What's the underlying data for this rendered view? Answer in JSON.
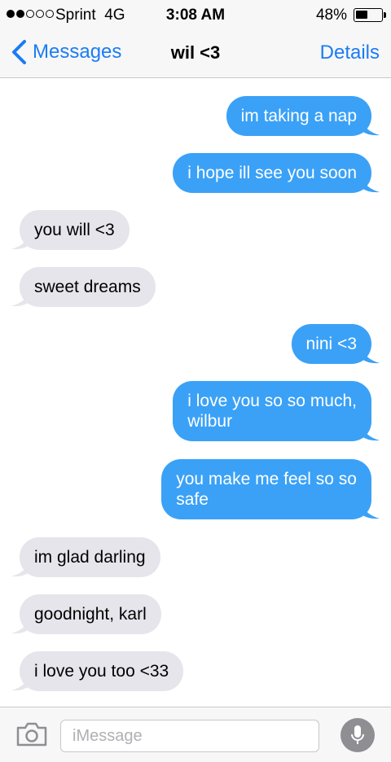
{
  "status_bar": {
    "carrier": "Sprint",
    "network": "4G",
    "signal_bars_filled": 2,
    "signal_bars_total": 5,
    "time": "3:08 AM",
    "battery_text": "48%",
    "battery_level": 0.48
  },
  "nav": {
    "back_label": "Messages",
    "title": "wil <3",
    "details_label": "Details"
  },
  "messages": [
    {
      "direction": "sent",
      "text": "im taking a nap"
    },
    {
      "direction": "sent",
      "text": "i hope ill see you soon"
    },
    {
      "direction": "received",
      "text": "you will <3"
    },
    {
      "direction": "received",
      "text": "sweet dreams"
    },
    {
      "direction": "sent",
      "text": "nini <3"
    },
    {
      "direction": "sent",
      "text": "i love you so so much,\nwilbur"
    },
    {
      "direction": "sent",
      "text": "you make me feel so so\nsafe"
    },
    {
      "direction": "received",
      "text": "im glad darling"
    },
    {
      "direction": "received",
      "text": "goodnight, karl"
    },
    {
      "direction": "received",
      "text": "i love you too <33"
    }
  ],
  "input_bar": {
    "placeholder": "iMessage",
    "camera_icon": "camera-icon",
    "mic_icon": "microphone-icon"
  },
  "colors": {
    "accent": "#1a7cf5",
    "sent_bubble": "#3aa1f7",
    "received_bubble": "#e6e5eb"
  }
}
